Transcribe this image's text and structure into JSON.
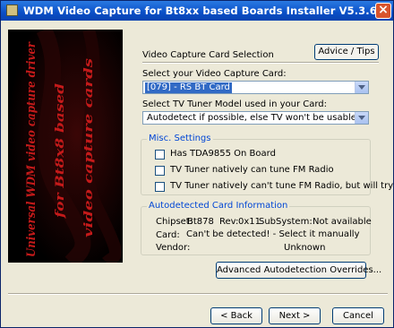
{
  "window": {
    "title": "WDM Video Capture for Bt8xx based Boards Installer V5.3.6-1",
    "close": "×"
  },
  "banner": {
    "line1": "Universal WDM video capture driver",
    "line2": "for Bt8x8 based",
    "line3": "video capture cards"
  },
  "section": {
    "title": "Video Capture Card Selection",
    "advice_label": "Advice / Tips"
  },
  "card_select": {
    "label": "Select your Video Capture Card:",
    "value": "[079] - RS BT Card"
  },
  "tuner_select": {
    "label": "Select TV Tuner Model used in your Card:",
    "value": "Autodetect if possible, else TV won't be usable"
  },
  "misc": {
    "title": "Misc. Settings",
    "options": [
      {
        "label": "Has TDA9855 On Board",
        "checked": false
      },
      {
        "label": "TV Tuner natively can tune FM Radio",
        "checked": false
      },
      {
        "label": "TV Tuner natively can't tune FM Radio, but will try",
        "checked": false
      }
    ]
  },
  "autodetect": {
    "title": "Autodetected Card Information",
    "chipset_label": "Chipset:",
    "chipset_value": "Bt878",
    "rev_label": "Rev:",
    "rev_value": "0x11",
    "subsystem_label": "SubSystem:",
    "subsystem_value": "Not available",
    "card_label": "Card:",
    "card_value": "Can't be detected! - Select it manually",
    "vendor_label": "Vendor:",
    "vendor_value": "Unknown",
    "overrides_label": "Advanced Autodetection Overrides..."
  },
  "nav": {
    "back_label": "< Back",
    "next_label": "Next >",
    "cancel_label": "Cancel"
  },
  "colors": {
    "titlebar": "#0a4fc7",
    "group_title": "#0046d5",
    "banner_text": "#c41a1a",
    "selection": "#316ac5"
  }
}
